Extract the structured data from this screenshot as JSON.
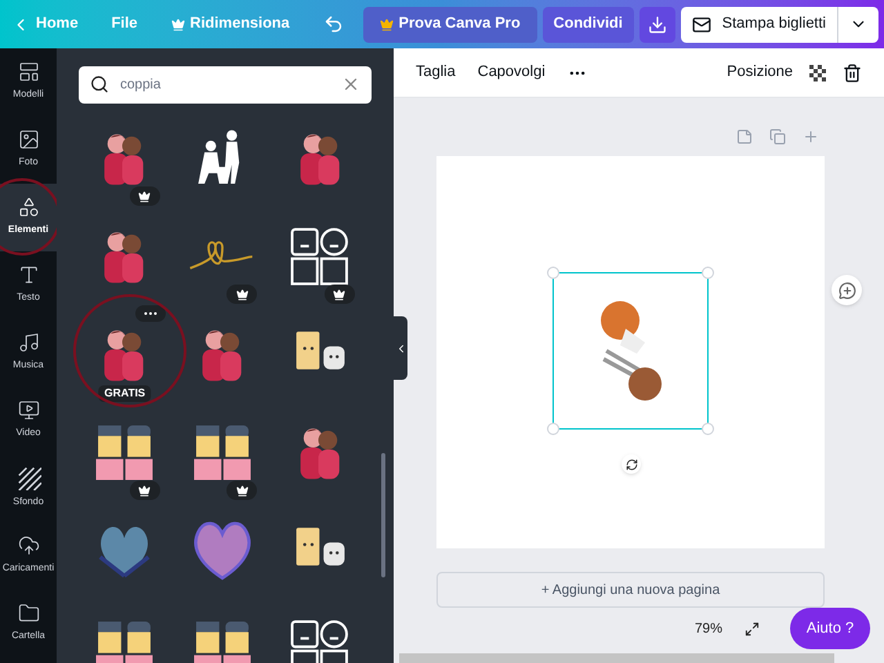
{
  "top_bar": {
    "home": "Home",
    "file": "File",
    "resize": "Ridimensiona",
    "try_pro": "Prova Canva Pro",
    "share": "Condividi",
    "print": "Stampa biglietti"
  },
  "sidebar": {
    "items": [
      {
        "label": "Modelli",
        "kind": "templates",
        "selected": false,
        "circled": false
      },
      {
        "label": "Foto",
        "kind": "photos",
        "selected": false,
        "circled": false
      },
      {
        "label": "Elementi",
        "kind": "elements",
        "selected": true,
        "circled": true
      },
      {
        "label": "Testo",
        "kind": "text",
        "selected": false,
        "circled": false
      },
      {
        "label": "Musica",
        "kind": "music",
        "selected": false,
        "circled": false
      },
      {
        "label": "Video",
        "kind": "video",
        "selected": false,
        "circled": false
      },
      {
        "label": "Sfondo",
        "kind": "background",
        "selected": false,
        "circled": false
      },
      {
        "label": "Caricamenti",
        "kind": "uploads",
        "selected": false,
        "circled": false
      },
      {
        "label": "Cartella",
        "kind": "folder",
        "selected": false,
        "circled": false
      }
    ]
  },
  "search": {
    "value": "coppia"
  },
  "results": [
    {
      "kind": "couple",
      "premium": true,
      "circled": false,
      "hovered": false
    },
    {
      "kind": "silhouette",
      "premium": false,
      "circled": false,
      "hovered": false
    },
    {
      "kind": "couple",
      "premium": false,
      "circled": false,
      "hovered": false
    },
    {
      "kind": "couple",
      "premium": false,
      "circled": false,
      "hovered": false
    },
    {
      "kind": "scribble",
      "premium": true,
      "circled": false,
      "hovered": false
    },
    {
      "kind": "outline",
      "premium": true,
      "circled": false,
      "hovered": false
    },
    {
      "kind": "couple",
      "premium": false,
      "free_label": "GRATIS",
      "circled": true,
      "hovered": true
    },
    {
      "kind": "couple",
      "premium": false,
      "circled": false,
      "hovered": false
    },
    {
      "kind": "snacks",
      "premium": false,
      "circled": false,
      "hovered": false
    },
    {
      "kind": "blocks",
      "premium": true,
      "circled": false,
      "hovered": false
    },
    {
      "kind": "blocks",
      "premium": true,
      "circled": false,
      "hovered": false
    },
    {
      "kind": "couple",
      "premium": false,
      "circled": false,
      "hovered": false
    },
    {
      "kind": "leaves",
      "premium": false,
      "circled": false,
      "hovered": false
    },
    {
      "kind": "heart",
      "premium": false,
      "circled": false,
      "hovered": false
    },
    {
      "kind": "snacks",
      "premium": false,
      "circled": false,
      "hovered": false
    },
    {
      "kind": "blocks",
      "circled": false,
      "hovered": false
    },
    {
      "kind": "blocks",
      "circled": false,
      "hovered": false
    },
    {
      "kind": "outline",
      "circled": false,
      "hovered": false
    }
  ],
  "toolbar": {
    "crop": "Taglia",
    "flip": "Capovolgi",
    "position": "Posizione"
  },
  "canvas": {
    "add_page": "+ Aggiungi una nuova pagina",
    "zoom": "79%",
    "help": "Aiuto ?"
  }
}
